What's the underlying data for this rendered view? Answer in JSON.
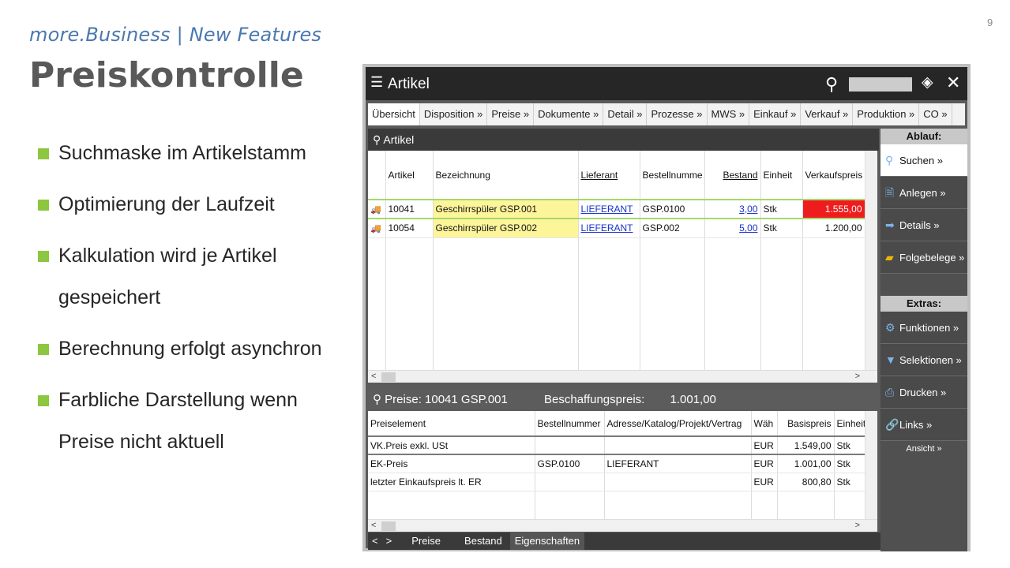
{
  "slide": {
    "number": "9",
    "subtitle": "more.Business | New Features",
    "title": "Preiskontrolle",
    "bullets": [
      "Suchmaske im Artikelstamm",
      "Optimierung der Laufzeit",
      "Kalkulation wird je Artikel gespeichert",
      "Berechnung erfolgt asynchron",
      "Farbliche Darstellung wenn Preise nicht aktuell"
    ],
    "bullet_color": "#8dc63f"
  },
  "window": {
    "title": "Artikel",
    "menu_icon": "hamburger-icon",
    "tabs": [
      "Übersicht",
      "Disposition »",
      "Preise »",
      "Dokumente »",
      "Detail »",
      "Prozesse »",
      "MWS »",
      "Einkauf »",
      "Verkauf »",
      "Produktion »",
      "CO »"
    ],
    "active_tab": "Übersicht"
  },
  "artikel": {
    "section_title": "Artikel",
    "columns": [
      "Artikel",
      "Bezeichnung",
      "Lieferant",
      "Bestellnumme",
      "Bestand",
      "Einheit",
      "Verkaufspreis"
    ],
    "rows": [
      {
        "artikel": "10041",
        "bezeichnung": "Geschirrspüler GSP.001",
        "lieferant": "LIEFERANT",
        "bestellnummer": "GSP.0100",
        "bestand": "3,00",
        "einheit": "Stk",
        "verkaufspreis": "1.555,00",
        "highlight": "#ee1c1c"
      },
      {
        "artikel": "10054",
        "bezeichnung": "Geschirrspüler GSP.002",
        "lieferant": "LIEFERANT",
        "bestellnummer": "GSP.002",
        "bestand": "5,00",
        "einheit": "Stk",
        "verkaufspreis": "1.200,00"
      }
    ]
  },
  "preise": {
    "section_title": "Preise: 10041 GSP.001",
    "beschaffung_label": "Beschaffungspreis:",
    "beschaffung_value": "1.001,00",
    "columns": [
      "Preiselement",
      "Bestellnummer",
      "Adresse/Katalog/Projekt/Vertrag",
      "Wäh",
      "Basispreis",
      "Einheit"
    ],
    "rows": [
      {
        "element": "VK.Preis exkl. USt",
        "bestellnummer": "",
        "adresse": "",
        "waehrung": "EUR",
        "basispreis": "1.549,00",
        "einheit": "Stk"
      },
      {
        "element": "EK-Preis",
        "bestellnummer": "GSP.0100",
        "adresse": "LIEFERANT",
        "waehrung": "EUR",
        "basispreis": "1.001,00",
        "einheit": "Stk"
      },
      {
        "element": "letzter Einkaufspreis lt. ER",
        "bestellnummer": "",
        "adresse": "",
        "waehrung": "EUR",
        "basispreis": "800,80",
        "einheit": "Stk"
      }
    ]
  },
  "sidebar": {
    "ablauf_label": "Ablauf:",
    "ablauf": [
      "Suchen »",
      "Anlegen »",
      "Details »",
      "Folgebelege »"
    ],
    "extras_label": "Extras:",
    "extras": [
      "Funktionen »",
      "Selektionen »",
      "Drucken »",
      "Links »"
    ],
    "view_label": "Ansicht »"
  },
  "bottom_tabs": {
    "prev": "<",
    "next": ">",
    "items": [
      "Preise",
      "Bestand",
      "Eigenschaften"
    ]
  }
}
